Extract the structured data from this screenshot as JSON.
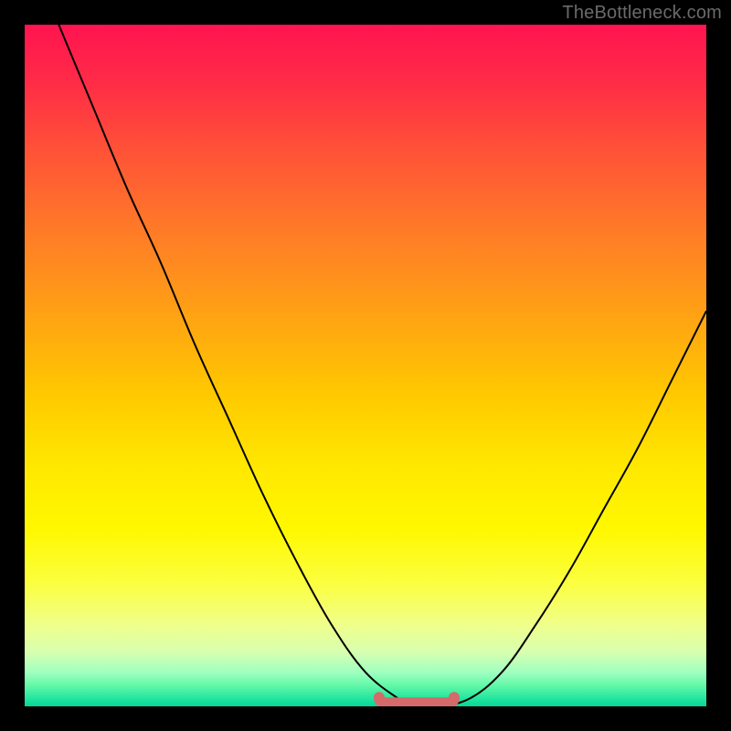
{
  "watermark": "TheBottleneck.com",
  "chart_data": {
    "type": "line",
    "title": "",
    "xlabel": "",
    "ylabel": "",
    "xlim": [
      0,
      100
    ],
    "ylim": [
      0,
      100
    ],
    "series": [
      {
        "name": "curve",
        "x": [
          5,
          10,
          15,
          20,
          25,
          30,
          35,
          40,
          45,
          50,
          55,
          57,
          60,
          65,
          70,
          75,
          80,
          85,
          90,
          95,
          100
        ],
        "values": [
          100,
          88,
          76,
          65,
          53,
          42,
          31,
          21,
          12,
          5,
          1,
          0,
          0,
          1,
          5,
          12,
          20,
          29,
          38,
          48,
          58
        ]
      }
    ],
    "bottom_marker": {
      "x_start": 52,
      "x_end": 63,
      "y": 0.5
    },
    "background_gradient": {
      "top": "#ff1450",
      "mid": "#ffe800",
      "bottom": "#00d898"
    }
  }
}
